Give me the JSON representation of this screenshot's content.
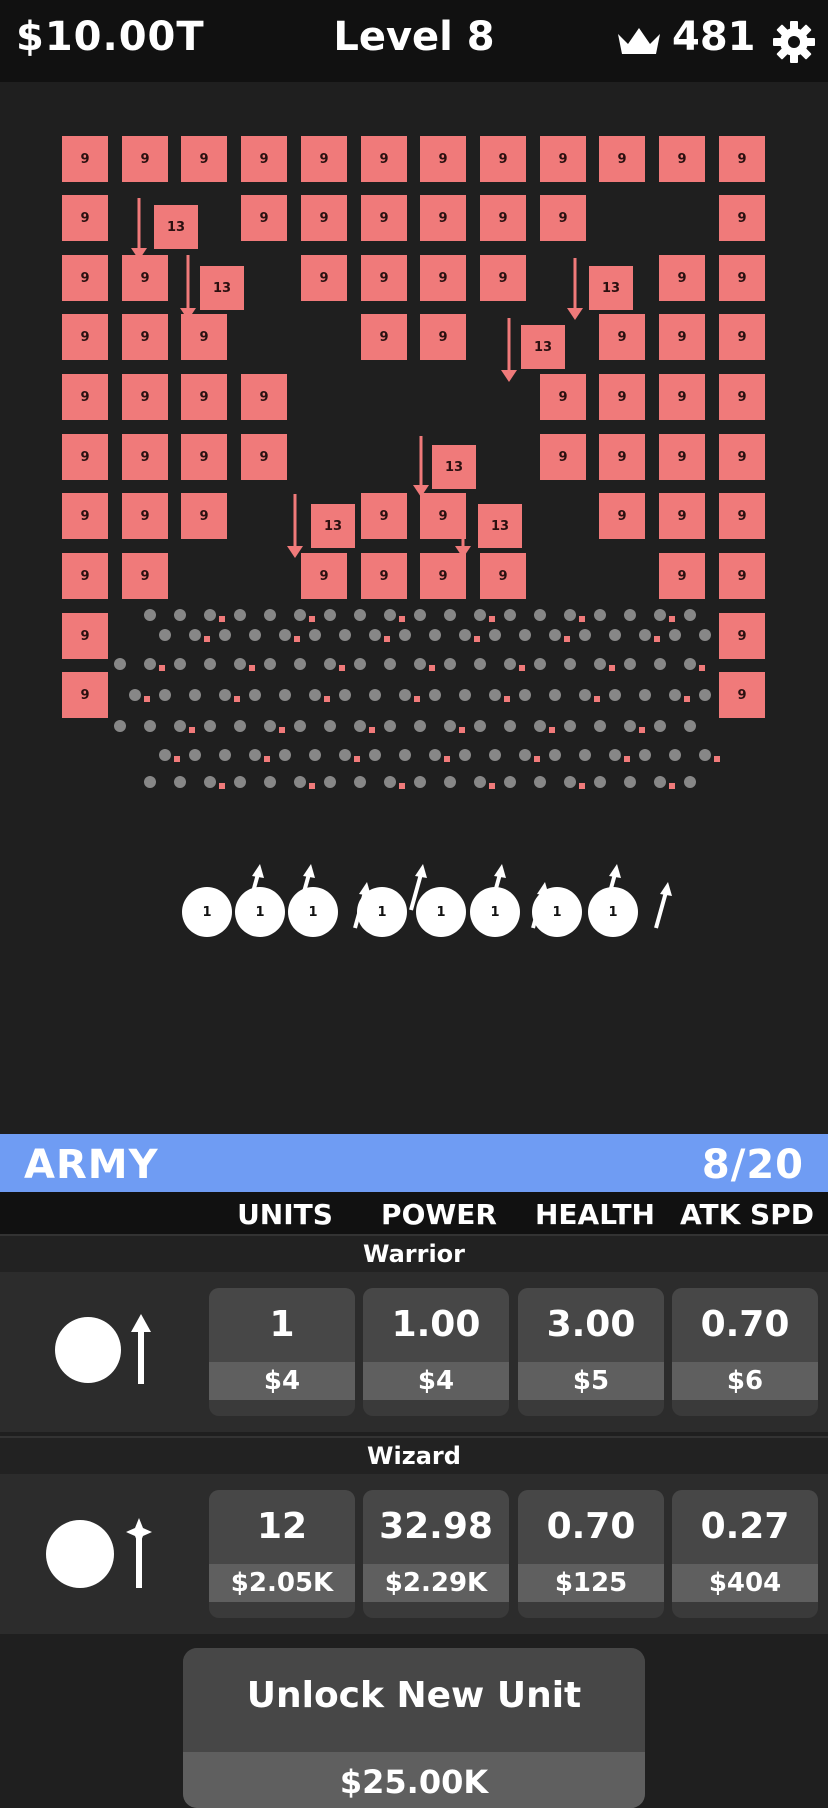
{
  "header": {
    "money": "$10.00T",
    "level": "Level 8",
    "gems": "481",
    "crown_icon": "crown-icon",
    "settings_icon": "gear-icon"
  },
  "playfield": {
    "brick_value": "9",
    "flying_brick_value": "13",
    "unit_value": "1",
    "brick_color": "#f07a7a",
    "unit_color": "#ffffff"
  },
  "army": {
    "title": "ARMY",
    "count": "8/20",
    "accent": "#6f9cf3",
    "columns": [
      "UNITS",
      "POWER",
      "HEALTH",
      "ATK SPD"
    ],
    "unit_types": [
      {
        "name": "Warrior",
        "icon": "warrior-icon",
        "stats": [
          {
            "value": "1",
            "cost": "$4"
          },
          {
            "value": "1.00",
            "cost": "$4"
          },
          {
            "value": "3.00",
            "cost": "$5"
          },
          {
            "value": "0.70",
            "cost": "$6"
          }
        ]
      },
      {
        "name": "Wizard",
        "icon": "wizard-icon",
        "stats": [
          {
            "value": "12",
            "cost": "$2.05K"
          },
          {
            "value": "32.98",
            "cost": "$2.29K"
          },
          {
            "value": "0.70",
            "cost": "$125"
          },
          {
            "value": "0.27",
            "cost": "$404"
          }
        ]
      }
    ]
  },
  "unlock": {
    "label": "Unlock New Unit",
    "cost": "$25.00K"
  }
}
